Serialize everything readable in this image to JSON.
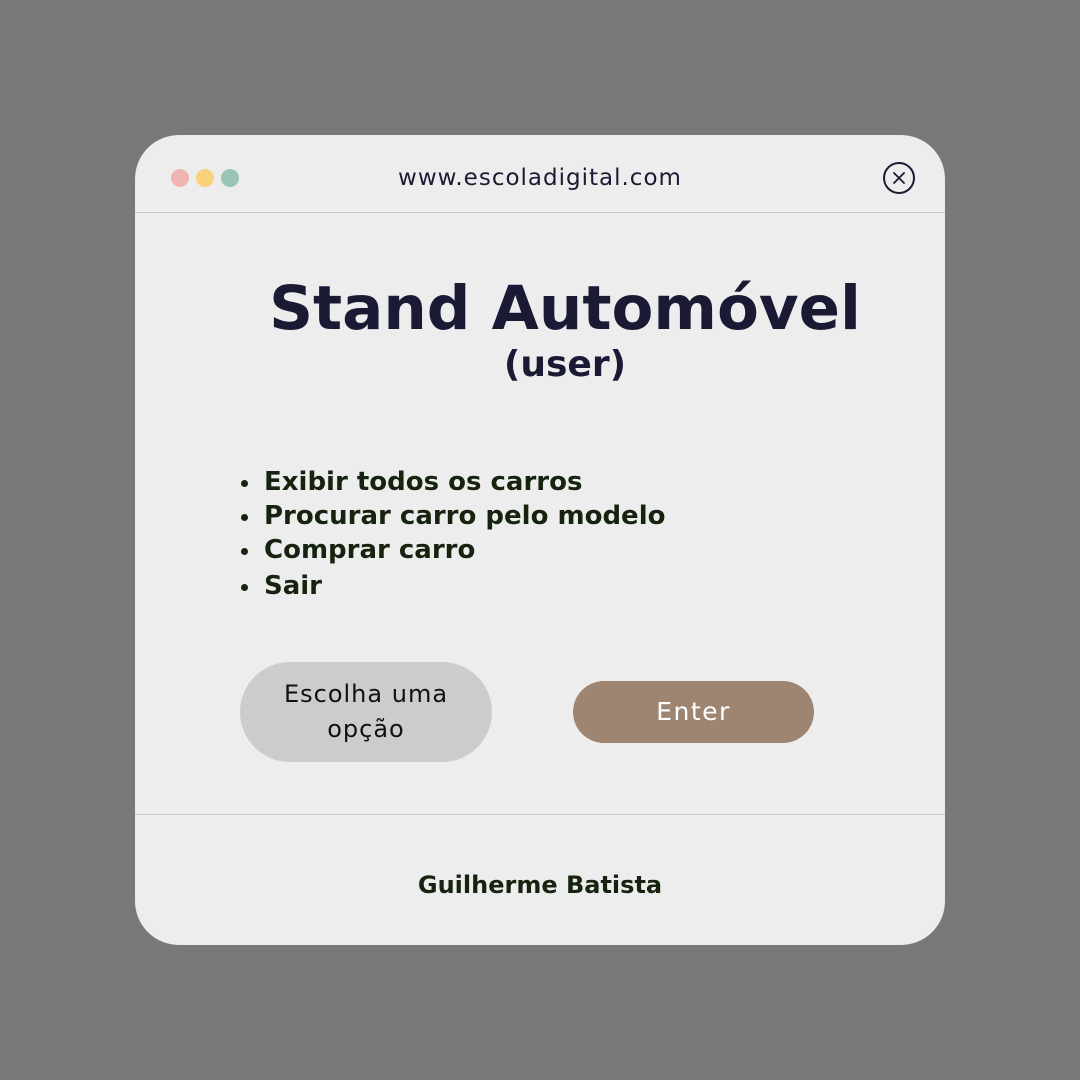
{
  "window": {
    "url": "www.escoladigital.com",
    "traffic_lights": {
      "red": "#f0b4b0",
      "yellow": "#f7d27a",
      "green": "#99c4b8"
    },
    "close_icon": "close-circle-icon"
  },
  "main": {
    "title": "Stand Automóvel",
    "subtitle": "(user)",
    "menu_items": [
      "Exibir todos os carros",
      "Procurar carro pelo modelo",
      "Comprar carro",
      "Sair"
    ],
    "option_input": {
      "placeholder": "Escolha uma opção"
    },
    "enter_button": {
      "label": "Enter"
    }
  },
  "footer": {
    "author": "Guilherme Batista"
  },
  "colors": {
    "background": "#7a7977",
    "window_bg": "#ededed",
    "title_text": "#1b1a35",
    "menu_text": "#16240f",
    "input_bg": "#cdcbcc",
    "button_bg": "#9e8572"
  }
}
